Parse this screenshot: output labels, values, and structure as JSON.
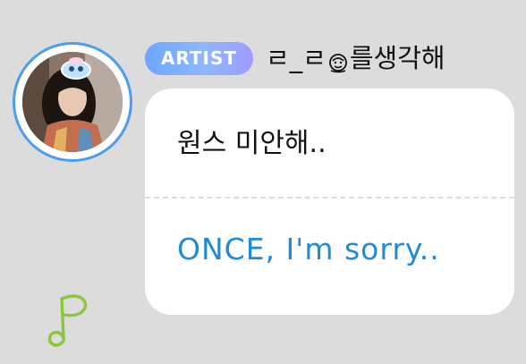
{
  "message": {
    "badge_label": "ARTIST",
    "sender": {
      "prefix": "ㄹ_ㄹ",
      "emoji_icon": "melting-face-emoji-icon",
      "suffix": "를생각해"
    },
    "original_text": "원스 미안해..",
    "translated_text": "ONCE, I'm sorry.."
  },
  "decoration": {
    "icon": "music-note-icon",
    "color": "#8cc63f"
  },
  "colors": {
    "background": "#dcdcdc",
    "avatar_ring": "#4d9cf0",
    "badge_start": "#6da6ff",
    "badge_end": "#9f9bff",
    "translation_text": "#1f8ad6"
  }
}
